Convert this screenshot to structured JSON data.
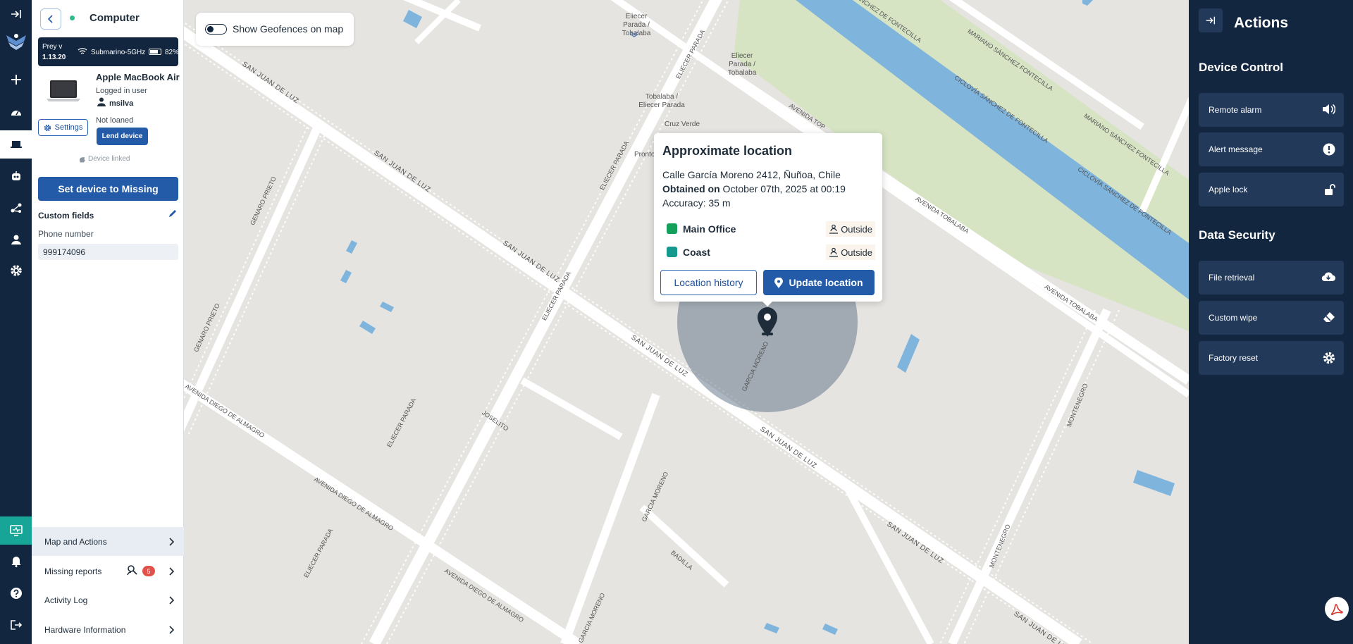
{
  "rail": {
    "items": [
      {
        "icon": "collapse-icon"
      },
      {
        "icon": "prey-logo-icon"
      },
      {
        "icon": "plus-icon"
      },
      {
        "icon": "dashboard-icon"
      },
      {
        "icon": "laptop-icon"
      },
      {
        "icon": "robot-icon"
      },
      {
        "icon": "network-icon"
      },
      {
        "icon": "user-icon"
      },
      {
        "icon": "gear-icon"
      },
      {
        "icon": "monitor-icon"
      },
      {
        "icon": "bell-icon"
      },
      {
        "icon": "help-icon"
      },
      {
        "icon": "logout-icon"
      }
    ]
  },
  "device": {
    "type": "Computer",
    "prey_version_label": "Prey v",
    "prey_version": "1.13.20",
    "wifi": "Submarino-5GHz",
    "battery": "82%",
    "model": "Apple MacBook Air",
    "logged_in_label": "Logged in user",
    "user": "msilva",
    "loan_status": "Not loaned",
    "settings_label": "Settings",
    "lend_label": "Lend device",
    "linked_label": "Device linked",
    "missing_label": "Set device to Missing",
    "custom_fields_title": "Custom fields",
    "phone_label": "Phone number",
    "phone_value": "999174096"
  },
  "nav": {
    "map_actions": "Map and Actions",
    "missing_reports": "Missing reports",
    "missing_count": "5",
    "activity_log": "Activity Log",
    "hardware_info": "Hardware Information"
  },
  "map": {
    "geofence_toggle_label": "Show Geofences on map",
    "popup": {
      "title": "Approximate location",
      "address": "Calle García Moreno 2412, Ñuñoa, Chile",
      "obtained_label": "Obtained on",
      "obtained_value": " October 07th, 2025 at 00:19",
      "accuracy": "Accuracy: 35 m",
      "geofences": [
        {
          "name": "Main Office",
          "status": "Outside",
          "color": "#13a05a"
        },
        {
          "name": "Coast",
          "status": "Outside",
          "color": "#15988e"
        }
      ],
      "history_btn": "Location history",
      "update_btn": "Update location"
    },
    "labels": {
      "street_san_juan_de_luz": "SAN JUAN DE LUZ",
      "street_genaro_prieto": "GENARO PRIETO",
      "street_eliecer_parada": "ELIECER PARADA",
      "street_avenida_diego_de_almagro": "AVENIDA DIEGO DE ALMAGRO",
      "street_joselito": "JOSELITO",
      "street_garcia_moreno": "GARCIA MORENO",
      "street_badilla": "BADILLA",
      "street_montenegro": "MONTENEGRO",
      "street_avenida_tobalaba": "AVENIDA TOBALABA",
      "street_avenida_top": "AVENIDA TOP",
      "street_mariano_sanchez_fontecilla": "MARIANO SÁNCHEZ FONTECILLA",
      "street_ciclovia_sanchez_fontecilla": "CICLOVÍA SÁNCHEZ DE FONTECILLA",
      "street_sanchez_de_fontecilla": "SÁNCHEZ DE FONTECILLA",
      "stop_eliecer_parada_tobalaba": "Eliecer Parada / Tobalaba",
      "stop_tobalaba_eliecer_parada": "Tobalaba / Eliecer Parada",
      "stop_cruz_verde": "Cruz Verde",
      "stop_pronto": "Pronto"
    }
  },
  "actions": {
    "title": "Actions",
    "device_control_title": "Device Control",
    "device_control": [
      {
        "label": "Remote alarm",
        "icon": "speaker-icon"
      },
      {
        "label": "Alert message",
        "icon": "alert-icon"
      },
      {
        "label": "Apple lock",
        "icon": "unlock-icon"
      }
    ],
    "data_security_title": "Data Security",
    "data_security": [
      {
        "label": "File retrieval",
        "icon": "cloud-download-icon"
      },
      {
        "label": "Custom wipe",
        "icon": "eraser-icon"
      },
      {
        "label": "Factory reset",
        "icon": "gear-icon"
      }
    ]
  },
  "colors": {
    "navy": "#12263f",
    "primary": "#235ba8",
    "teal": "#16a596",
    "badge": "#e2504a",
    "river": "#7fb4dd",
    "park": "#d6e4c4"
  }
}
